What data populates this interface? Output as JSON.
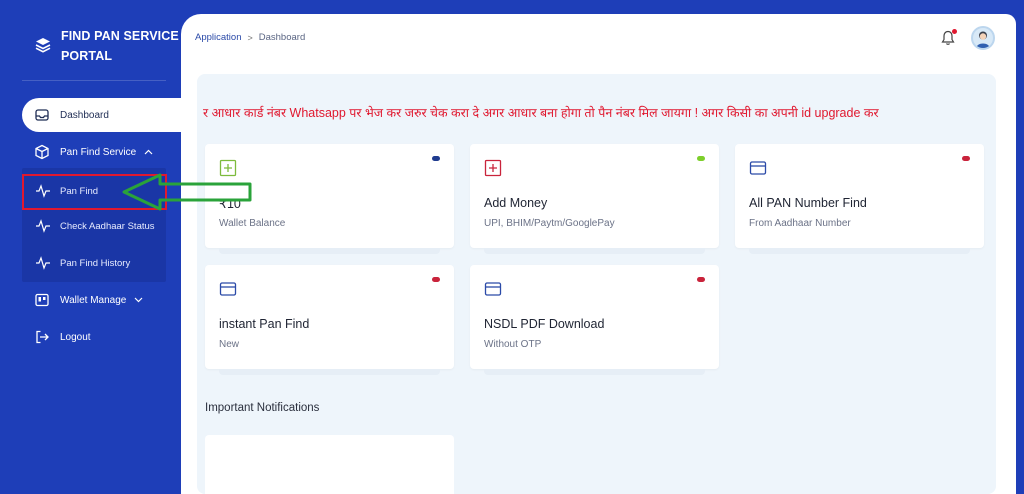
{
  "brand": {
    "title": "FIND PAN SERVICE PORTAL"
  },
  "nav": {
    "dashboard": "Dashboard",
    "pan_find_service": "Pan Find Service",
    "wallet_manage": "Wallet Manage",
    "logout": "Logout"
  },
  "submenu": {
    "pan_find": "Pan Find",
    "check_aadhaar": "Check Aadhaar Status",
    "history": "Pan Find History"
  },
  "breadcrumb": {
    "parent": "Application",
    "separator": ">",
    "current": "Dashboard"
  },
  "marquee": "र आधार कार्ड नंबर Whatsapp पर भेज कर जरुर चेक करा दे अगर आधार बना होगा तो पैन नंबर मिल जायगा ! अगर किसी का अपनी id upgrade कर",
  "cards": [
    {
      "value": "₹10",
      "label": "Wallet Balance",
      "icon": "plus-square-icon",
      "icon_color": "#7dbb3c",
      "pill_color": "#1f3b8f"
    },
    {
      "value": "Add Money",
      "label": "UPI, BHIM/Paytm/GooglePay",
      "icon": "plus-square-icon",
      "icon_color": "#c9233b",
      "pill_color": "#7dcf2b"
    },
    {
      "value": "All PAN Number Find",
      "label": "From Aadhaar Number",
      "icon": "card-icon",
      "icon_color": "#2b4aa8",
      "pill_color": "#c9233b"
    },
    {
      "value": "instant Pan Find",
      "label": "New",
      "icon": "card-icon",
      "icon_color": "#2b4aa8",
      "pill_color": "#c9233b"
    },
    {
      "value": "NSDL PDF Download",
      "label": "Without OTP",
      "icon": "card-icon",
      "icon_color": "#2b4aa8",
      "pill_color": "#c9233b"
    }
  ],
  "notifications": {
    "title": "Important Notifications"
  },
  "colors": {
    "sidebar": "#1e3eb8",
    "accent_red": "#e0182f",
    "arrow_green": "#2aa33a"
  }
}
